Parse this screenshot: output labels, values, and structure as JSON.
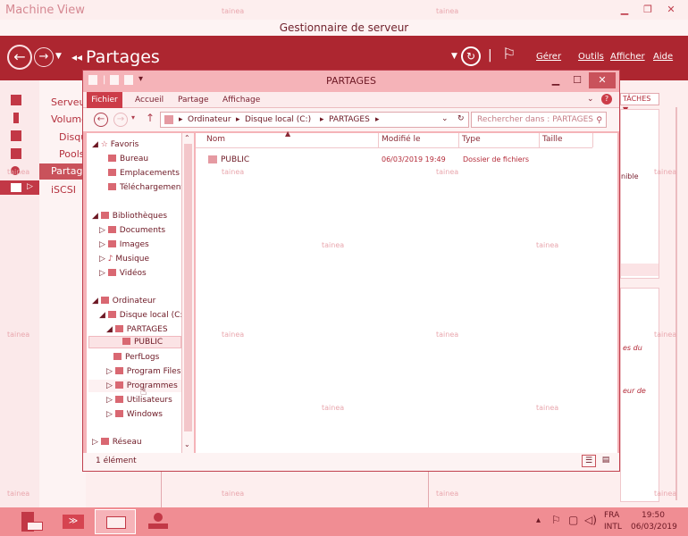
{
  "remote_bar": {
    "menu_machine": "Machine",
    "menu_view": "View"
  },
  "server_manager": {
    "title": "Gestionnaire de serveur",
    "breadcrumb": "Partages",
    "header_menu": {
      "manage": "Gérer",
      "tools": "Outils",
      "view": "Afficher",
      "help": "Aide"
    },
    "nav": [
      "Serveur",
      "Volume",
      "Disqu",
      "Pools",
      "Partage",
      "iSCSI"
    ],
    "right_fragments": {
      "taches": "TÂCHES",
      "dispo": "nible",
      "share1": "es du",
      "share2": "eur de"
    }
  },
  "explorer": {
    "title": "PARTAGES",
    "ribbon_tabs": [
      "Fichier",
      "Accueil",
      "Partage",
      "Affichage"
    ],
    "address": [
      "Ordinateur",
      "Disque local (C:)",
      "PARTAGES"
    ],
    "search_placeholder": "Rechercher dans : PARTAGES",
    "nav": {
      "favorites": "Favoris",
      "bureau": "Bureau",
      "emplacements": "Emplacements ré",
      "telechargements": "Téléchargements",
      "bibliotheques": "Bibliothèques",
      "documents": "Documents",
      "images": "Images",
      "musique": "Musique",
      "videos": "Vidéos",
      "ordinateur": "Ordinateur",
      "disque": "Disque local (C:)",
      "partages": "PARTAGES",
      "public": "PUBLIC",
      "perflogs": "PerfLogs",
      "programfiles": "Program Files (",
      "programmes": "Programmes",
      "utilisateurs": "Utilisateurs",
      "windows": "Windows",
      "reseau": "Réseau"
    },
    "columns": {
      "name": "Nom",
      "modified": "Modifié le",
      "type": "Type",
      "size": "Taille"
    },
    "rows": [
      {
        "name": "PUBLIC",
        "modified": "06/03/2019 19:49",
        "type": "Dossier de fichiers",
        "size": ""
      }
    ],
    "status": "1 élément"
  },
  "taskbar": {
    "lang": "FRA",
    "kbd": "INTL",
    "time": "19:50",
    "date": "06/03/2019"
  },
  "watermark": "tainea",
  "colors": {
    "accent": "#ad2630",
    "taskbar": "#f08d93"
  }
}
